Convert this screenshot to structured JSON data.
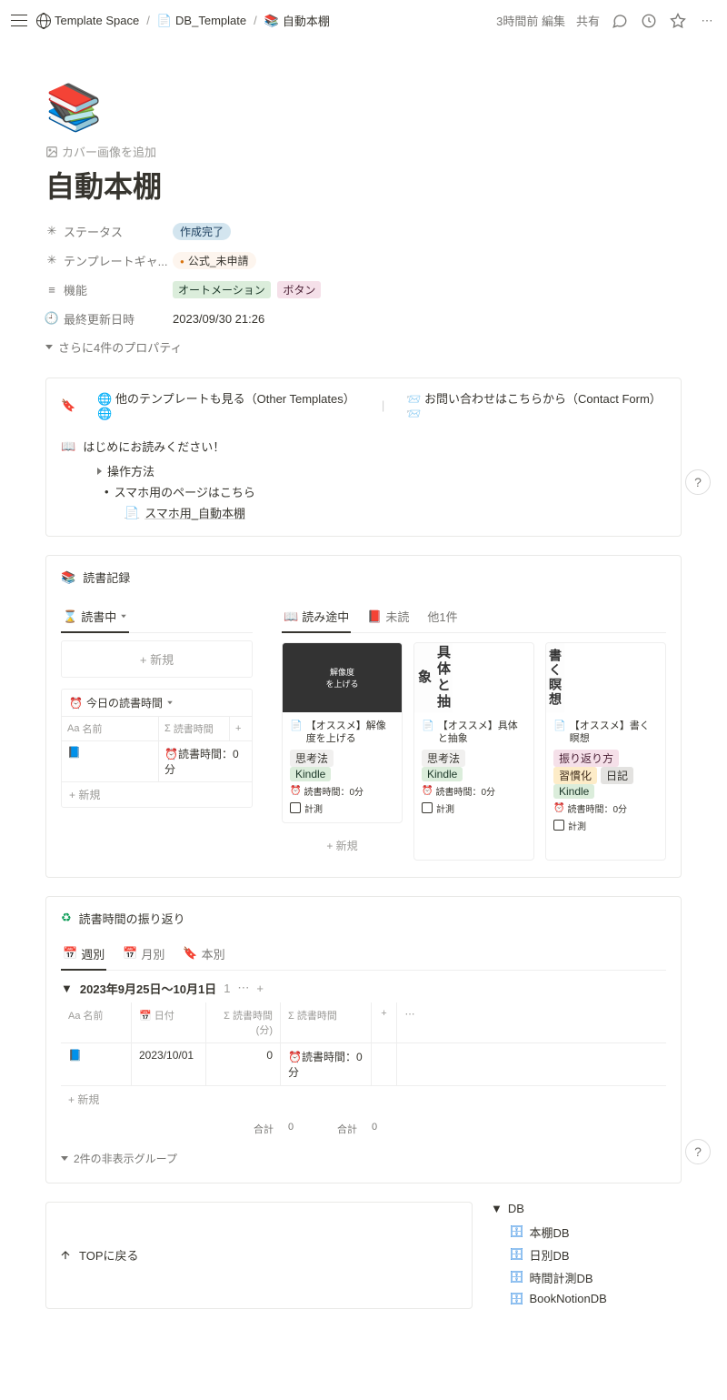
{
  "topbar": {
    "breadcrumb": [
      {
        "icon": "🌐",
        "label": "Template Space"
      },
      {
        "icon": "📄",
        "label": "DB_Template"
      },
      {
        "icon": "📚",
        "label": "自動本棚"
      }
    ],
    "edited": "3時間前 編集",
    "share": "共有"
  },
  "page": {
    "emoji": "📚",
    "add_cover": "カバー画像を追加",
    "title": "自動本棚",
    "properties": [
      {
        "icon": "✳",
        "label": "ステータス",
        "type": "status",
        "value": "作成完了"
      },
      {
        "icon": "✳",
        "label": "テンプレートギャ...",
        "type": "status2",
        "value": "公式_未申請"
      },
      {
        "icon": "≡",
        "label": "機能",
        "type": "tags",
        "tags": [
          {
            "text": "オートメーション",
            "cls": "green"
          },
          {
            "text": "ボタン",
            "cls": "pink"
          }
        ]
      },
      {
        "icon": "🕘",
        "label": "最終更新日時",
        "type": "text",
        "value": "2023/09/30 21:26"
      }
    ],
    "show_more": "さらに4件のプロパティ"
  },
  "callout": {
    "link1": "他のテンプレートも見る（Other Templates）",
    "link2": "お問い合わせはこちらから（Contact Form）",
    "readme": "はじめにお読みください！",
    "toggle": "操作方法",
    "bullet": "スマホ用のページはこちら",
    "page_link": "スマホ用_自動本棚"
  },
  "reading": {
    "header": "読書記録",
    "left_tab": "読書中",
    "new": "新規",
    "today_header": "今日の読書時間",
    "cols": {
      "name": "名前",
      "time": "読書時間"
    },
    "row": {
      "icon": "📘",
      "time_label": "読書時間：0分"
    },
    "right_tabs": [
      {
        "icon": "📖",
        "label": "読み途中",
        "active": true
      },
      {
        "icon": "📕",
        "label": "未読",
        "active": false
      },
      {
        "label": "他1件",
        "active": false
      }
    ],
    "cards": [
      {
        "img_style": "dark",
        "img_text": "解像度\nを上げる",
        "title": "【オススメ】解像度を上げる",
        "tags": [
          {
            "text": "思考法",
            "cls": "default"
          },
          {
            "text": "Kindle",
            "cls": "green"
          }
        ],
        "time": "読書時間：0分",
        "measure": "計測"
      },
      {
        "img_style": "white",
        "img_text": "具体と抽象",
        "title": "【オススメ】具体と抽象",
        "tags": [
          {
            "text": "思考法",
            "cls": "default"
          },
          {
            "text": "Kindle",
            "cls": "green"
          }
        ],
        "time": "読書時間：0分",
        "measure": "計測"
      },
      {
        "img_style": "white",
        "img_text": "書く瞑想",
        "title": "【オススメ】書く瞑想",
        "tags": [
          {
            "text": "振り返り方",
            "cls": "pink"
          },
          {
            "text": "習慣化",
            "cls": "yellow"
          },
          {
            "text": "日記",
            "cls": "gray"
          },
          {
            "text": "Kindle",
            "cls": "green"
          }
        ],
        "time": "読書時間：0分",
        "measure": "計測"
      }
    ]
  },
  "review": {
    "header": "読書時間の振り返り",
    "tabs": [
      {
        "icon": "📅",
        "label": "週別",
        "active": true
      },
      {
        "icon": "📅",
        "label": "月別",
        "active": false
      },
      {
        "icon": "🔖",
        "label": "本別",
        "active": false
      }
    ],
    "group": {
      "title": "2023年9月25日〜10月1日",
      "count": "1"
    },
    "cols": {
      "name": "名前",
      "date": "日付",
      "min": "読書時間(分)",
      "time": "読書時間"
    },
    "row": {
      "icon": "📘",
      "date": "2023/10/01",
      "min": "0",
      "time": "読書時間：0分"
    },
    "new": "新規",
    "sum_label": "合計",
    "sum_min": "0",
    "sum_time": "0",
    "hidden": "2件の非表示グループ"
  },
  "footer": {
    "back": "TOPに戻る",
    "db_header": "DB",
    "db_items": [
      "本棚DB",
      "日別DB",
      "時間計測DB",
      "BookNotionDB"
    ]
  }
}
